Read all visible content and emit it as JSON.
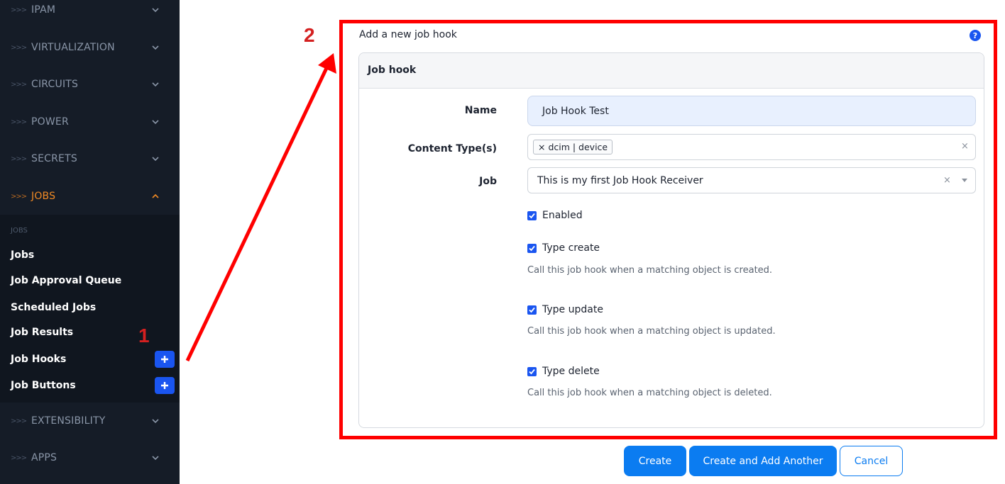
{
  "sidebar": {
    "sections_top": [
      {
        "prefix": ">>>",
        "label": "IPAM"
      },
      {
        "prefix": ">>>",
        "label": "VIRTUALIZATION"
      },
      {
        "prefix": ">>>",
        "label": "CIRCUITS"
      },
      {
        "prefix": ">>>",
        "label": "POWER"
      },
      {
        "prefix": ">>>",
        "label": "SECRETS"
      },
      {
        "prefix": ">>>",
        "label": "JOBS"
      }
    ],
    "sub_heading": "JOBS",
    "sub_items": [
      "Jobs",
      "Job Approval Queue",
      "Scheduled Jobs",
      "Job Results",
      "Job Hooks",
      "Job Buttons"
    ],
    "sections_bottom": [
      {
        "prefix": ">>>",
        "label": "EXTENSIBILITY"
      },
      {
        "prefix": ">>>",
        "label": "APPS"
      }
    ],
    "active_color": "#f08a24"
  },
  "annotations": {
    "step1": "1",
    "step2": "2",
    "color": "#ff0000"
  },
  "form": {
    "title": "Add a new job hook",
    "help_icon": "?",
    "panel_heading": "Job hook",
    "name_label": "Name",
    "name_value": "Job Hook Test",
    "content_types_label": "Content Type(s)",
    "content_type_tag": "× dcim | device",
    "job_label": "Job",
    "job_value": "This is my first Job Hook Receiver",
    "clear_glyph": "×",
    "enabled_label": "Enabled",
    "type_create_label": "Type create",
    "type_create_help": "Call this job hook when a matching object is created.",
    "type_update_label": "Type update",
    "type_update_help": "Call this job hook when a matching object is updated.",
    "type_delete_label": "Type delete",
    "type_delete_help": "Call this job hook when a matching object is deleted."
  },
  "buttons": {
    "create": "Create",
    "create_another": "Create and Add Another",
    "cancel": "Cancel"
  },
  "colors": {
    "primary": "#0b7cf1",
    "sidebar_bg": "#151c27",
    "plus_btn": "#1a55f0"
  }
}
